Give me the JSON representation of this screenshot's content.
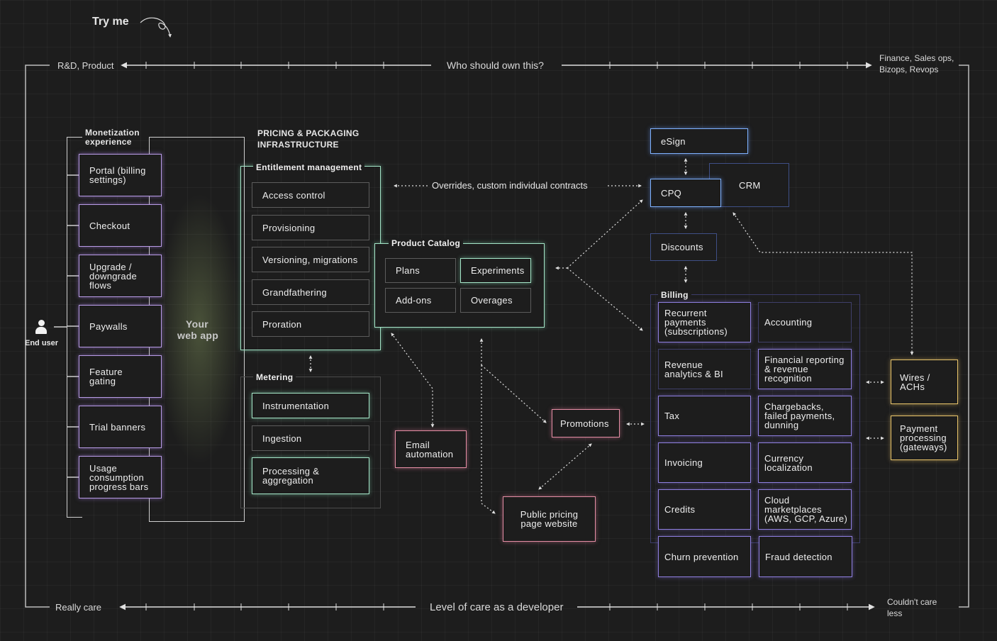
{
  "header": {
    "try_me": "Try me"
  },
  "top_axis": {
    "left": "R&D, Product",
    "center": "Who should own this?",
    "right_line1": "Finance, Sales ops,",
    "right_line2": "Bizops, Revops"
  },
  "bottom_axis": {
    "left": "Really care",
    "center": "Level of care as a developer",
    "right_line1": "Couldn't care",
    "right_line2": "less"
  },
  "end_user": {
    "label": "End user"
  },
  "monetization": {
    "title_line1": "Monetization",
    "title_line2": "experience",
    "items": [
      "Portal (billing\nsettings)",
      "Checkout",
      "Upgrade /\ndowngrade\nflows",
      "Paywalls",
      "Feature\ngating",
      "Trial banners",
      "Usage\nconsumption\nprogress bars"
    ]
  },
  "web_app": {
    "line1": "Your",
    "line2": "web app"
  },
  "pricing_infra": {
    "line1": "PRICING & PACKAGING",
    "line2": "INFRASTRUCTURE"
  },
  "entitlement": {
    "title": "Entitlement management",
    "items": [
      "Access control",
      "Provisioning",
      "Versioning, migrations",
      "Grandfathering",
      "Proration"
    ]
  },
  "metering": {
    "title": "Metering",
    "items": [
      "Instrumentation",
      "Ingestion",
      "Processing &\naggregation"
    ]
  },
  "catalog": {
    "title": "Product Catalog",
    "items": [
      "Plans",
      "Experiments",
      "Add-ons",
      "Overages"
    ]
  },
  "overrides_label": "Overrides, custom individual contracts",
  "email": "Email\nautomation",
  "promotions": "Promotions",
  "public_pricing": "Public pricing\npage website",
  "esign": "eSign",
  "cpq": "CPQ",
  "crm": "CRM",
  "discounts": "Discounts",
  "billing": {
    "title": "Billing",
    "items": [
      "Recurrent\npayments\n(subscriptions)",
      "Accounting",
      "Revenue\nanalytics & BI",
      "Financial reporting\n& revenue\nrecognition",
      "Tax",
      "Chargebacks,\nfailed payments,\ndunning",
      "Invoicing",
      "Currency\nlocalization",
      "Credits",
      "Cloud\nmarketplaces\n(AWS, GCP, Azure)"
    ]
  },
  "churn": "Churn prevention",
  "fraud": "Fraud detection",
  "wires": "Wires /\nACHs",
  "payment_processing": "Payment\nprocessing\n(gateways)"
}
